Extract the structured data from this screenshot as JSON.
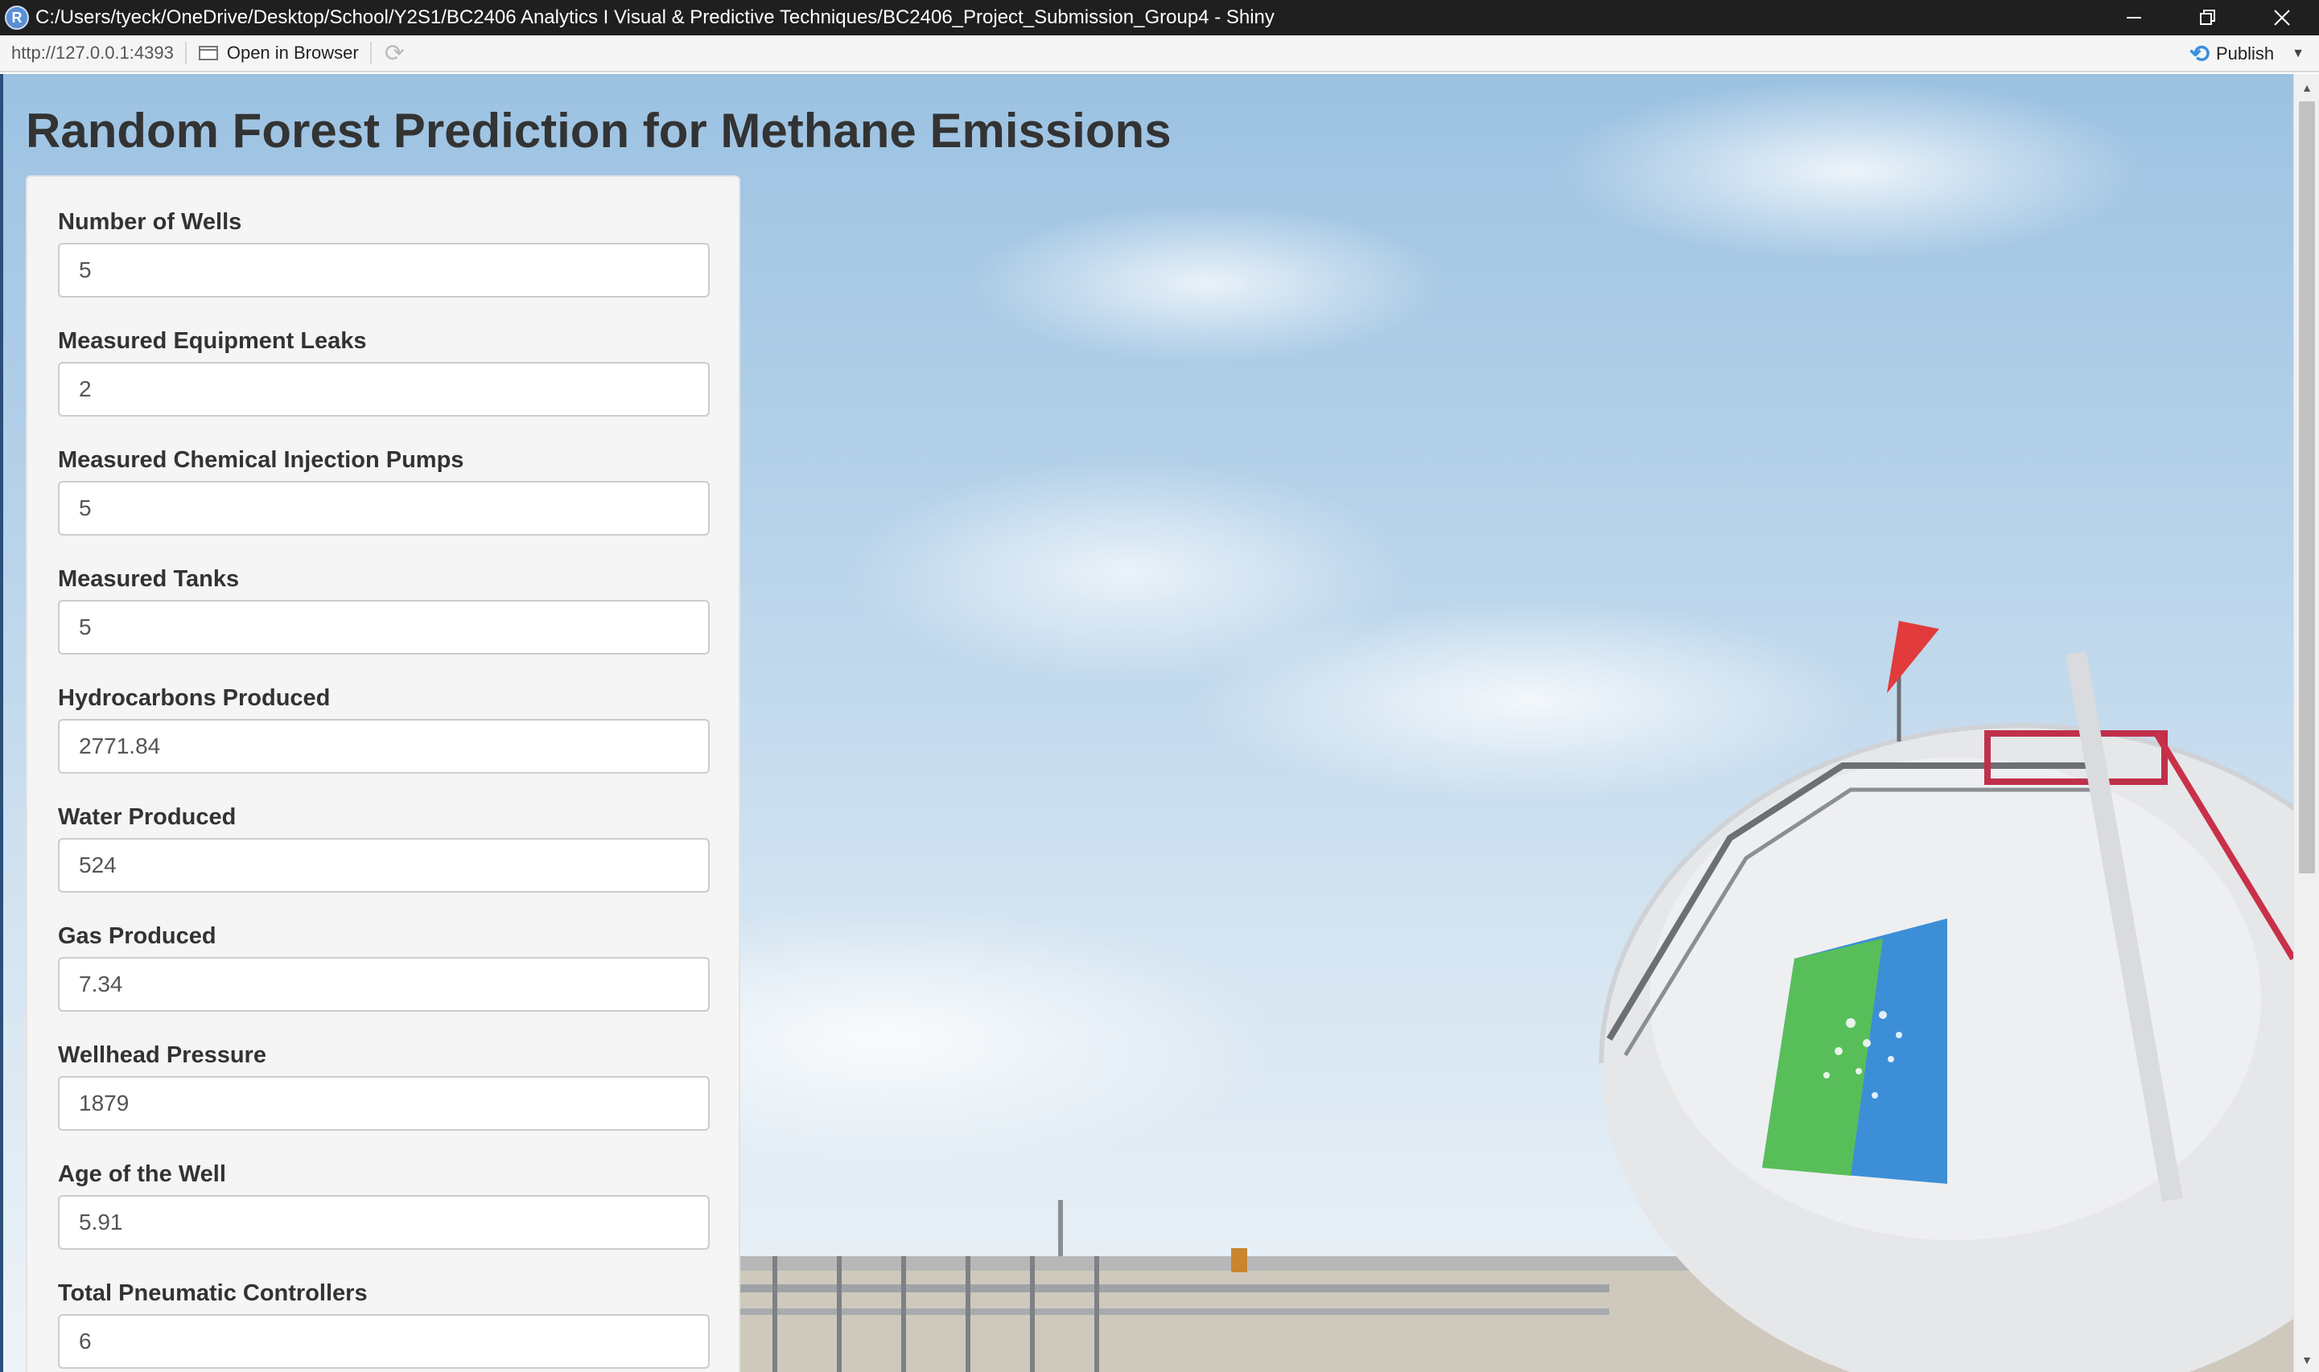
{
  "window": {
    "title": "C:/Users/tyeck/OneDrive/Desktop/School/Y2S1/BC2406 Analytics I Visual & Predictive Techniques/BC2406_Project_Submission_Group4 - Shiny",
    "app_icon_letter": "R"
  },
  "toolbar": {
    "url": "http://127.0.0.1:4393",
    "open_in_browser": "Open in Browser",
    "publish": "Publish"
  },
  "page": {
    "title": "Random Forest Prediction for Methane Emissions"
  },
  "fields": [
    {
      "label": "Number of Wells",
      "value": "5"
    },
    {
      "label": "Measured Equipment Leaks",
      "value": "2"
    },
    {
      "label": "Measured Chemical Injection Pumps",
      "value": "5"
    },
    {
      "label": "Measured Tanks",
      "value": "5"
    },
    {
      "label": "Hydrocarbons Produced",
      "value": "2771.84"
    },
    {
      "label": "Water Produced",
      "value": "524"
    },
    {
      "label": "Gas Produced",
      "value": "7.34"
    },
    {
      "label": "Wellhead Pressure",
      "value": "1879"
    },
    {
      "label": "Age of the Well",
      "value": "5.91"
    },
    {
      "label": "Total Pneumatic Controllers",
      "value": "6"
    }
  ],
  "icons": {
    "minimize": "minimize-icon",
    "restore": "restore-icon",
    "close": "close-icon",
    "open_browser": "browser-window-icon",
    "refresh": "refresh-icon",
    "publish": "publish-icon"
  }
}
